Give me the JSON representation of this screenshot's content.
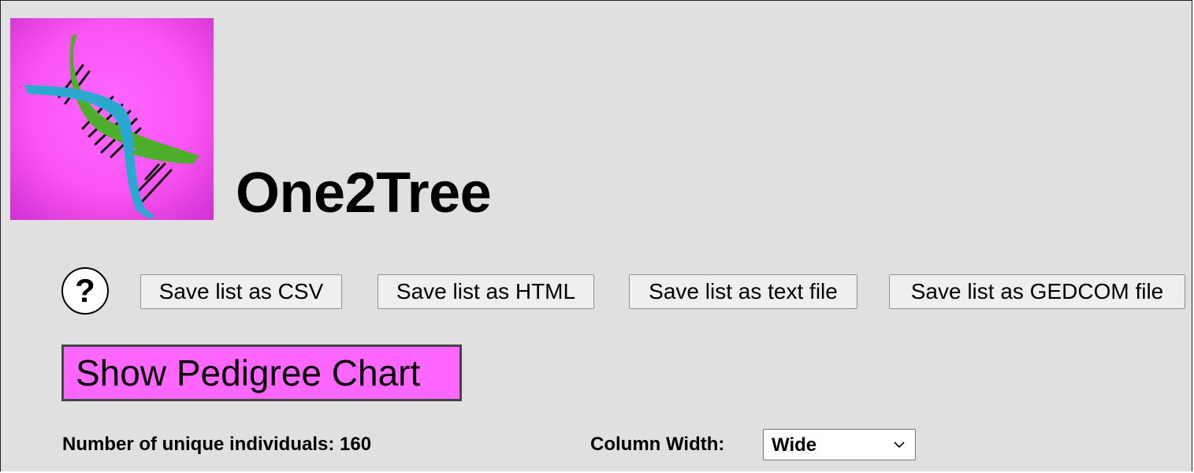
{
  "app": {
    "title": "One2Tree",
    "logo_icon": "dna-helix-icon",
    "logo_bg_color": "#ff66ff"
  },
  "toolbar": {
    "help_label": "?",
    "save_csv_label": "Save list as CSV",
    "save_html_label": "Save list as HTML",
    "save_text_label": "Save list as text file",
    "save_gedcom_label": "Save list as GEDCOM file"
  },
  "pedigree": {
    "button_label": "Show Pedigree Chart",
    "button_color": "#ff66ff"
  },
  "stats": {
    "unique_individuals_label": "Number of unique individuals: 160"
  },
  "column_width": {
    "label": "Column Width:",
    "selected": "Wide"
  }
}
